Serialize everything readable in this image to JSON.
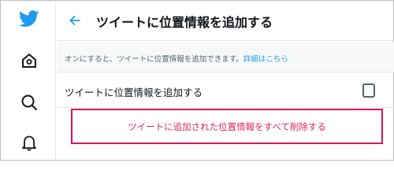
{
  "sidebar": {
    "icons": [
      "twitter-bird-logo",
      "home-icon",
      "explore-search-icon",
      "notifications-bell-icon"
    ]
  },
  "header": {
    "back_icon": "arrow-left",
    "title": "ツイートに位置情報を追加する"
  },
  "description": {
    "text": "オンにすると、ツイートに位置情報を追加できます。",
    "link_label": "詳細はこちら"
  },
  "option": {
    "label": "ツイートに位置情報を追加する",
    "checked": false
  },
  "delete_action": {
    "label": "ツイートに追加された位置情報をすべて削除する"
  },
  "colors": {
    "accent": "#1d9bf0",
    "danger_text": "#e0245e",
    "highlight_border": "#d9145a"
  }
}
